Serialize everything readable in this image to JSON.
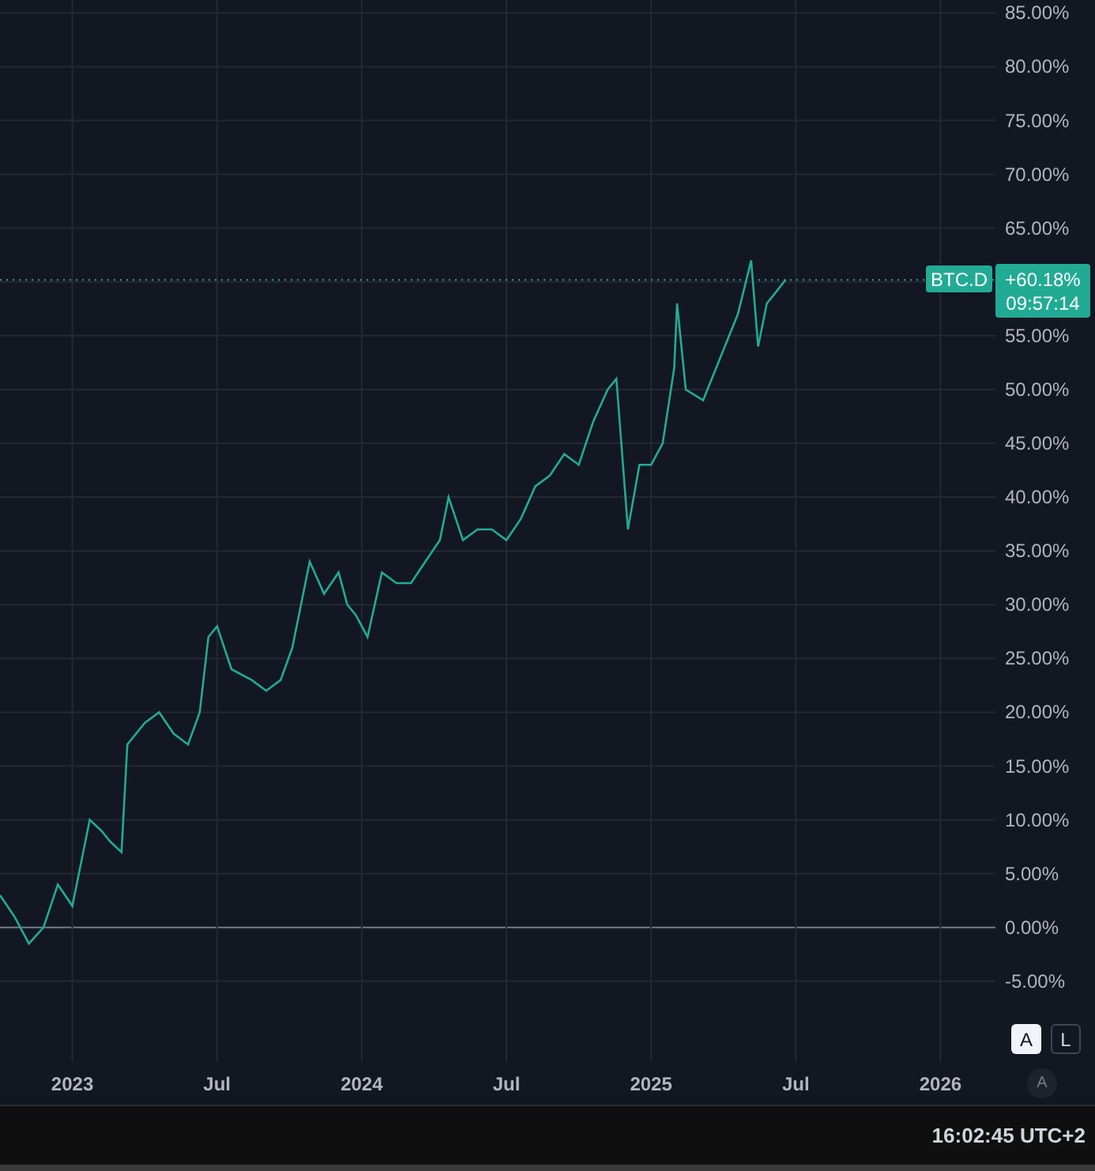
{
  "chart": {
    "chart_data": {
      "type": "line",
      "x": [
        2022.75,
        2022.8,
        2022.85,
        2022.9,
        2022.95,
        2023.0,
        2023.03,
        2023.06,
        2023.1,
        2023.13,
        2023.17,
        2023.19,
        2023.25,
        2023.3,
        2023.35,
        2023.4,
        2023.44,
        2023.47,
        2023.5,
        2023.55,
        2023.62,
        2023.67,
        2023.72,
        2023.76,
        2023.82,
        2023.87,
        2023.92,
        2023.95,
        2023.98,
        2024.02,
        2024.07,
        2024.12,
        2024.17,
        2024.22,
        2024.27,
        2024.3,
        2024.35,
        2024.4,
        2024.45,
        2024.5,
        2024.55,
        2024.6,
        2024.65,
        2024.7,
        2024.75,
        2024.8,
        2024.85,
        2024.88,
        2024.92,
        2024.96,
        2025.0,
        2025.04,
        2025.08,
        2025.09,
        2025.12,
        2025.18,
        2025.24,
        2025.3,
        2025.346,
        2025.37,
        2025.4,
        2025.43,
        2025.465
      ],
      "series": [
        {
          "name": "BTC.D",
          "color": "#22ab94",
          "values": [
            3,
            1,
            -1.5,
            0,
            4,
            2,
            6,
            10,
            9,
            8,
            7,
            17,
            19,
            20,
            18,
            17,
            20,
            27,
            28,
            24,
            23,
            22,
            23,
            26,
            34,
            31,
            33,
            30,
            29,
            27,
            33,
            32,
            32,
            34,
            36,
            40,
            36,
            37,
            37,
            36,
            38,
            41,
            42,
            44,
            43,
            47,
            50,
            51,
            37,
            43,
            43,
            45,
            52,
            58,
            50,
            49,
            53,
            57,
            62,
            54,
            58,
            59,
            60.2
          ]
        }
      ],
      "grid": true,
      "ref_lines": [
        {
          "axis": "y",
          "value": 60.18,
          "label": "+60.18%",
          "color": "#22ab94"
        }
      ],
      "xlim": [
        2022.75,
        2026.19
      ],
      "ylim": [
        -12.5,
        86.2
      ],
      "xticks": [
        {
          "value": 2023,
          "label": "2023"
        },
        {
          "value": 2023.5,
          "label": "Jul"
        },
        {
          "value": 2024,
          "label": "2024"
        },
        {
          "value": 2024.5,
          "label": "Jul"
        },
        {
          "value": 2025,
          "label": "2025"
        },
        {
          "value": 2025.5,
          "label": "Jul"
        },
        {
          "value": 2026,
          "label": "2026"
        }
      ],
      "yticks": [
        {
          "value": 85,
          "label": "85.00%"
        },
        {
          "value": 80,
          "label": "80.00%"
        },
        {
          "value": 75,
          "label": "75.00%"
        },
        {
          "value": 70,
          "label": "70.00%"
        },
        {
          "value": 65,
          "label": "65.00%"
        },
        {
          "value": 55,
          "label": "55.00%"
        },
        {
          "value": 50,
          "label": "50.00%"
        },
        {
          "value": 45,
          "label": "45.00%"
        },
        {
          "value": 40,
          "label": "40.00%"
        },
        {
          "value": 35,
          "label": "35.00%"
        },
        {
          "value": 30,
          "label": "30.00%"
        },
        {
          "value": 25,
          "label": "25.00%"
        },
        {
          "value": 20,
          "label": "20.00%"
        },
        {
          "value": 15,
          "label": "15.00%"
        },
        {
          "value": 10,
          "label": "10.00%"
        },
        {
          "value": 5,
          "label": "5.00%"
        },
        {
          "value": 0,
          "label": "0.00%"
        },
        {
          "value": -5,
          "label": "-5.00%"
        }
      ]
    },
    "countdown": "09:57:14"
  },
  "scale_buttons": [
    {
      "label": "A",
      "selected": true
    },
    {
      "label": "L",
      "selected": false
    }
  ],
  "auto_button": "A",
  "status_bar": {
    "time": "16:02:45 UTC+2"
  }
}
